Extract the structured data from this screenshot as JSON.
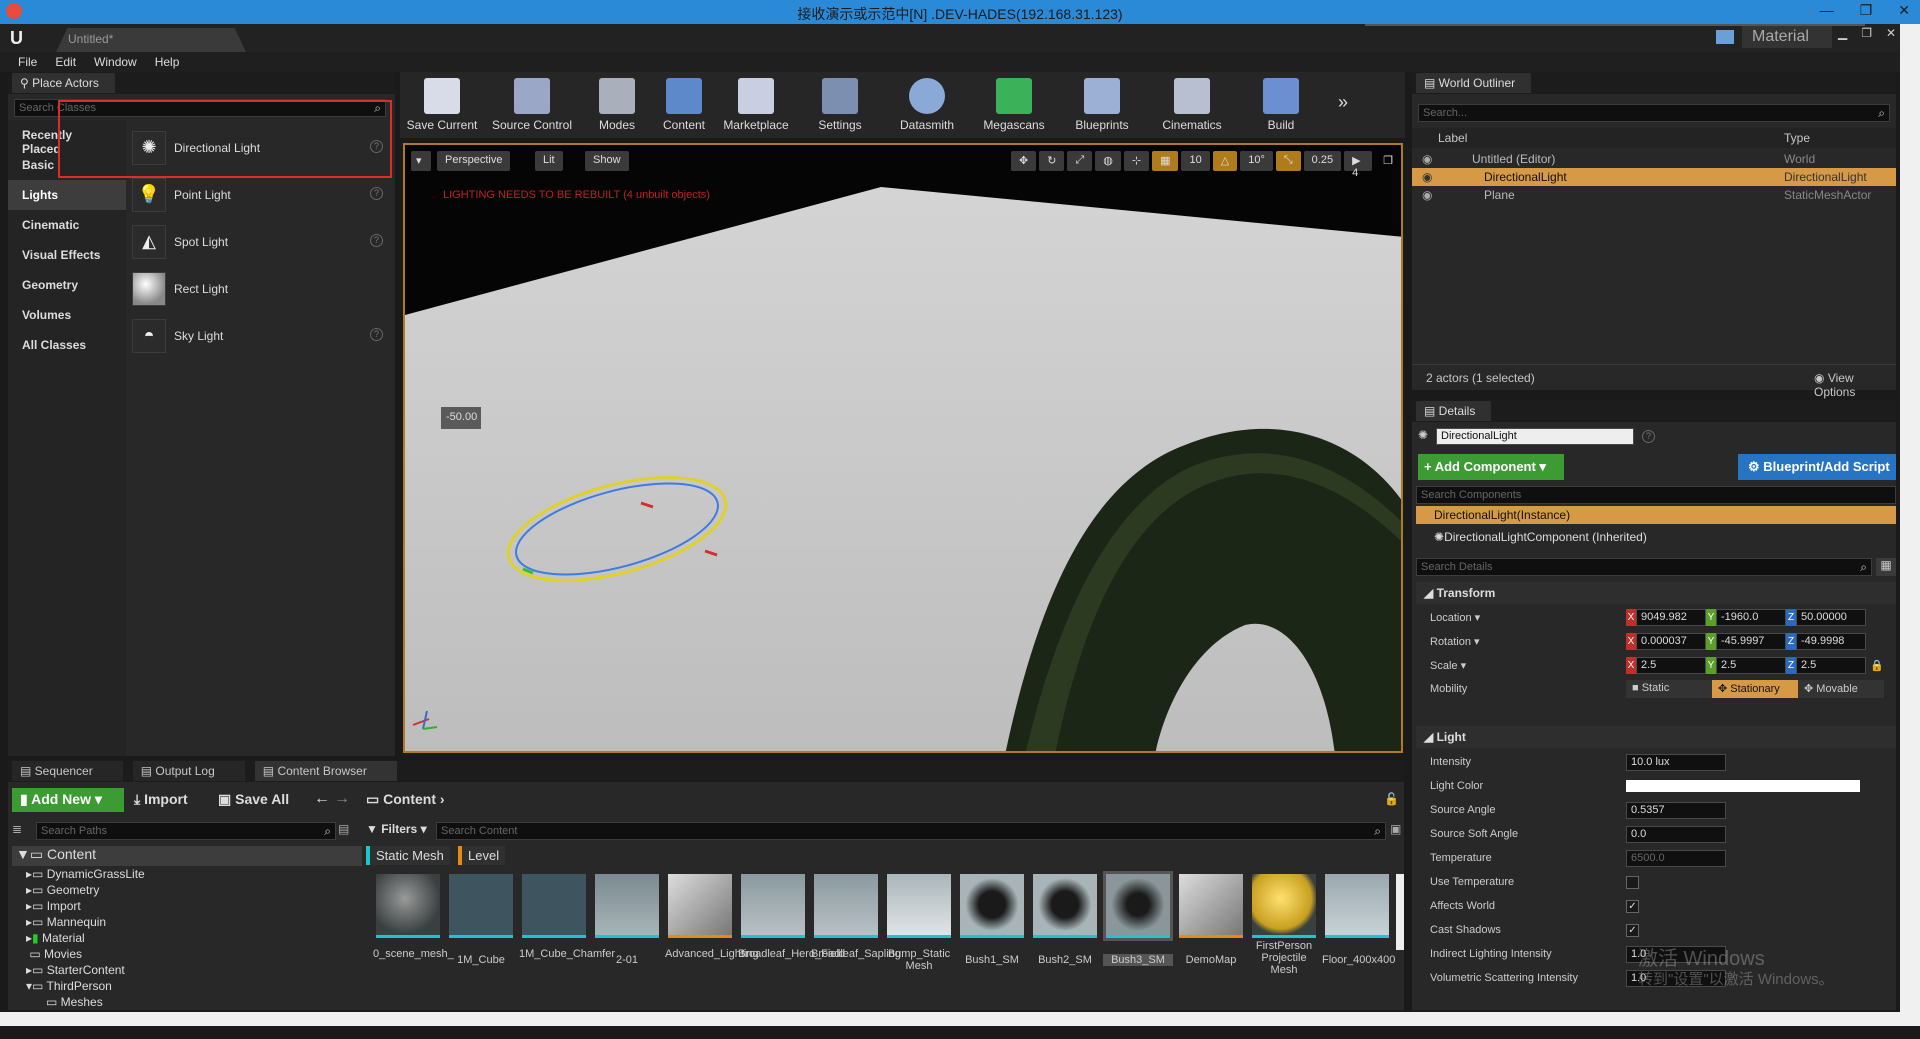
{
  "remote": {
    "title": "接收演示或示范中[N] .DEV-HADES(192.168.31.123)"
  },
  "window": {
    "tab": "Untitled*",
    "right_badge": "Material"
  },
  "menu": [
    "File",
    "Edit",
    "Window",
    "Help"
  ],
  "place_actors": {
    "tab": "Place Actors",
    "search_placeholder": "Search Classes",
    "categories": [
      "Recently Placed",
      "Basic",
      "Lights",
      "Cinematic",
      "Visual Effects",
      "Geometry",
      "Volumes",
      "All Classes"
    ],
    "selected_category": "Lights",
    "items": [
      "Directional Light",
      "Point Light",
      "Spot Light",
      "Rect Light",
      "Sky Light"
    ]
  },
  "toolbar": [
    "Save Current",
    "Source Control",
    "Modes",
    "Content",
    "Marketplace",
    "Settings",
    "Datasmith",
    "Megascans",
    "Blueprints",
    "Cinematics",
    "Build"
  ],
  "viewport": {
    "perspective": "Perspective",
    "lit": "Lit",
    "show": "Show",
    "grid": "10",
    "rot": "10°",
    "scale": "0.25",
    "cam": "4",
    "warning": "LIGHTING NEEDS TO BE REBUILT (4 unbuilt objects)",
    "value_box": "-50.00"
  },
  "outliner": {
    "tab": "World Outliner",
    "search_placeholder": "Search...",
    "col_label": "Label",
    "col_type": "Type",
    "rows": [
      {
        "label": "Untitled (Editor)",
        "type": "World"
      },
      {
        "label": "DirectionalLight",
        "type": "DirectionalLight"
      },
      {
        "label": "Plane",
        "type": "StaticMeshActor"
      }
    ],
    "footer": "2 actors (1 selected)",
    "view_options": "View Options"
  },
  "details": {
    "tab": "Details",
    "name": "DirectionalLight",
    "add_component": "+ Add Component ▾",
    "blueprint": "Blueprint/Add Script",
    "search_components": "Search Components",
    "instance": "DirectionalLight(Instance)",
    "component": "DirectionalLightComponent (Inherited)",
    "search_details": "Search Details",
    "transform_hdr": "Transform",
    "location_lbl": "Location ▾",
    "location": [
      "9049.982",
      "-1960.0",
      "50.00000"
    ],
    "rotation_lbl": "Rotation ▾",
    "rotation": [
      "0.000037",
      "-45.9997",
      "-49.9998"
    ],
    "scale_lbl": "Scale ▾",
    "scale": [
      "2.5",
      "2.5",
      "2.5"
    ],
    "mobility_lbl": "Mobility",
    "mobility": [
      "Static",
      "Stationary",
      "Movable"
    ],
    "light_hdr": "Light",
    "light_props": [
      {
        "label": "Intensity",
        "value": "10.0 lux"
      },
      {
        "label": "Light Color",
        "value": ""
      },
      {
        "label": "Source Angle",
        "value": "0.5357"
      },
      {
        "label": "Source Soft Angle",
        "value": "0.0"
      },
      {
        "label": "Temperature",
        "value": "6500.0"
      },
      {
        "label": "Use Temperature",
        "value": ""
      },
      {
        "label": "Affects World",
        "value": "✓"
      },
      {
        "label": "Cast Shadows",
        "value": "✓"
      },
      {
        "label": "Indirect Lighting Intensity",
        "value": "1.0"
      },
      {
        "label": "Volumetric Scattering Intensity",
        "value": "1.0"
      }
    ],
    "watermark1": "激活 Windows",
    "watermark2": "转到\"设置\"以激活 Windows。"
  },
  "bottom_tabs": [
    "Sequencer",
    "Output Log",
    "Content Browser"
  ],
  "content": {
    "add_new": "Add New ▾",
    "import": "Import",
    "save_all": "Save All",
    "path": "Content",
    "search_paths": "Search Paths",
    "filters": "Filters ▾",
    "search_content": "Search Content",
    "filter_chips": [
      "Static Mesh",
      "Level"
    ],
    "tree": [
      "Content",
      "DynamicGrassLite",
      "Geometry",
      "Import",
      "Mannequin",
      "Material",
      "Movies",
      "StarterContent",
      "ThirdPerson",
      "Meshes"
    ],
    "assets": [
      "0_scene_mesh_",
      "1M_Cube",
      "1M_Cube_Chamfer",
      "2-01",
      "Advanced_Lighting",
      "Broadleaf_Hero_Field",
      "Broadleaf_Sapling",
      "Bump_Static Mesh",
      "Bush1_SM",
      "Bush2_SM",
      "Bush3_SM",
      "DemoMap",
      "FirstPerson Projectile Mesh",
      "Floor_400x400"
    ]
  }
}
